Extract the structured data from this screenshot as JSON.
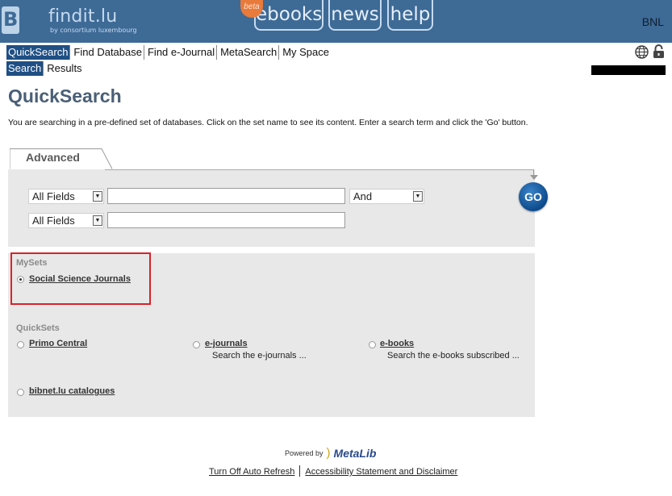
{
  "header": {
    "brand": "findit.lu",
    "brand_sub": "by consortium luxembourg",
    "beta_badge": "beta",
    "tabs": [
      {
        "label": "ebooks"
      },
      {
        "label": "news"
      },
      {
        "label": "help"
      }
    ],
    "institution": "BNL",
    "colors": {
      "header_bg": "#3e6a96",
      "nav_active": "#1f4f84",
      "title": "#4a5f77",
      "highlight_box": "#d9222a"
    }
  },
  "nav": {
    "primary": [
      {
        "label": "QuickSearch",
        "active": true
      },
      {
        "label": "Find Database"
      },
      {
        "label": "Find e-Journal"
      },
      {
        "label": "MetaSearch"
      },
      {
        "label": "My Space"
      }
    ],
    "secondary": [
      {
        "label": "Search",
        "active": true
      },
      {
        "label": "Results"
      }
    ],
    "icons": [
      "globe-icon",
      "lock-icon"
    ]
  },
  "page": {
    "title": "QuickSearch",
    "description": "You are searching in a pre-defined set of databases. Click on the set name to see its content. Enter a search term and click the 'Go' button."
  },
  "search": {
    "tab_label": "Advanced",
    "rows": [
      {
        "field": "All Fields",
        "value": "",
        "operator": "And"
      },
      {
        "field": "All Fields",
        "value": ""
      }
    ],
    "go_label": "GO"
  },
  "sets": {
    "mysets_label": "MySets",
    "mysets": [
      {
        "label": "Social Science Journals",
        "selected": true
      }
    ],
    "quicksets_label": "QuickSets",
    "quicksets": [
      {
        "label": "Primo Central",
        "description": ""
      },
      {
        "label": "e-journals",
        "description": "Search the e-journals ..."
      },
      {
        "label": "e-books",
        "description": "Search the e-books subscribed ..."
      },
      {
        "label": "bibnet.lu catalogues",
        "description": ""
      }
    ]
  },
  "footer": {
    "powered_by": "Powered by",
    "metalib": "MetaLib",
    "links": [
      "Turn Off Auto Refresh",
      "Accessibility Statement and Disclaimer"
    ]
  }
}
